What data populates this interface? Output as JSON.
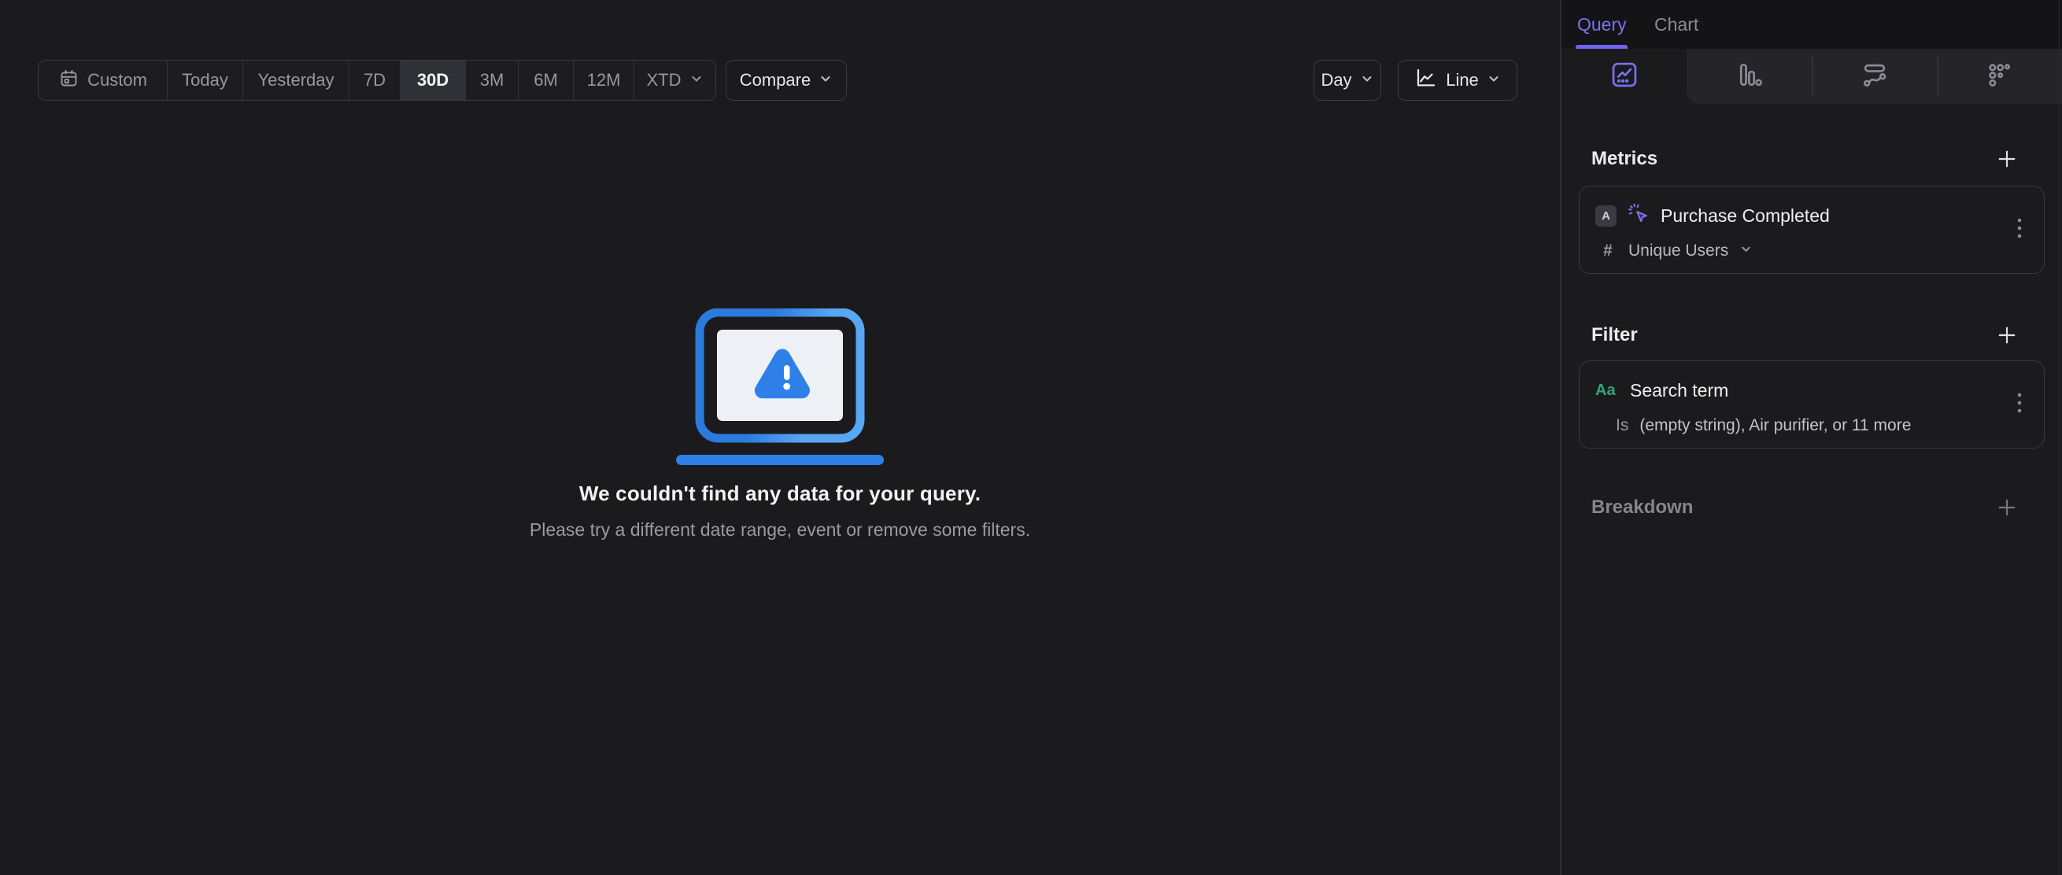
{
  "toolbar": {
    "segments": [
      {
        "label": "Custom"
      },
      {
        "label": "Today"
      },
      {
        "label": "Yesterday"
      },
      {
        "label": "7D"
      },
      {
        "label": "30D"
      },
      {
        "label": "3M"
      },
      {
        "label": "6M"
      },
      {
        "label": "12M"
      },
      {
        "label": "XTD"
      }
    ],
    "selected_segment": "30D",
    "compare_label": "Compare",
    "granularity_label": "Day",
    "chart_type_label": "Line"
  },
  "empty_state": {
    "title": "We couldn't find any data for your query.",
    "subtitle": "Please try a different date range, event or remove some filters."
  },
  "sidebar": {
    "tabs": {
      "query": "Query",
      "chart": "Chart",
      "active": "Query"
    },
    "metrics": {
      "heading": "Metrics",
      "event_badge": "A",
      "event_name": "Purchase Completed",
      "aggregation_symbol": "#",
      "aggregation": "Unique Users"
    },
    "filter": {
      "heading": "Filter",
      "property_type_glyph": "Aa",
      "property": "Search term",
      "operator": "Is",
      "values_summary": "(empty string), Air purifier, or 11 more"
    },
    "breakdown": {
      "heading": "Breakdown"
    }
  },
  "colors": {
    "accent_purple": "#7b70f2",
    "accent_green": "#2fa874",
    "illustration_blue": "#2e7de4",
    "illustration_blue_light": "#58a7f4",
    "selected_segment_bg": "#303137"
  }
}
